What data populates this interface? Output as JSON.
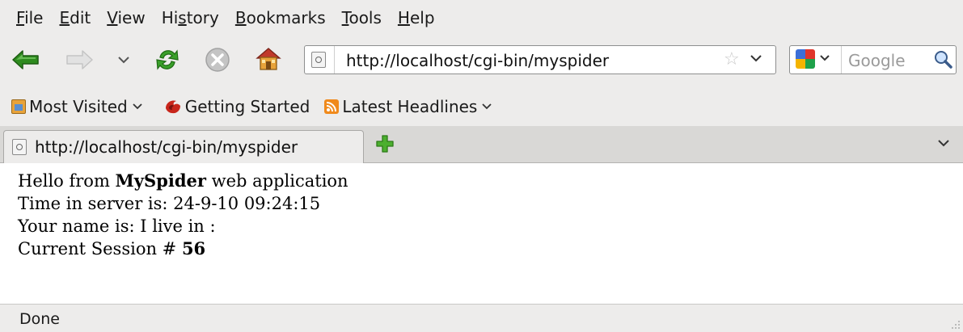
{
  "menubar": {
    "items": [
      {
        "prefix": "",
        "key": "F",
        "suffix": "ile"
      },
      {
        "prefix": "",
        "key": "E",
        "suffix": "dit"
      },
      {
        "prefix": "",
        "key": "V",
        "suffix": "iew"
      },
      {
        "prefix": "Hi",
        "key": "s",
        "suffix": "tory"
      },
      {
        "prefix": "",
        "key": "B",
        "suffix": "ookmarks"
      },
      {
        "prefix": "",
        "key": "T",
        "suffix": "ools"
      },
      {
        "prefix": "",
        "key": "H",
        "suffix": "elp"
      }
    ]
  },
  "navbar": {
    "url": "http://localhost/cgi-bin/myspider",
    "search_placeholder": "Google"
  },
  "bookmarks": {
    "items": [
      {
        "label": "Most Visited",
        "has_menu": true
      },
      {
        "label": "Getting Started",
        "has_menu": false
      },
      {
        "label": "Latest Headlines",
        "has_menu": true
      }
    ]
  },
  "tabs": {
    "active_label": "http://localhost/cgi-bin/myspider"
  },
  "content": {
    "line1_pre": "Hello from ",
    "line1_bold": "MySpider",
    "line1_post": " web application",
    "line2": "Time in server is: 24-9-10 09:24:15",
    "line3": "Your name is: I live in :",
    "line4_pre": "Current Session # ",
    "line4_bold": "56"
  },
  "status": {
    "text": "Done"
  },
  "colors": {
    "chrome_bg": "#edeceb",
    "back_arrow": "#2e8b1e",
    "reload": "#3aa02a",
    "stop": "#b8b8b8"
  }
}
